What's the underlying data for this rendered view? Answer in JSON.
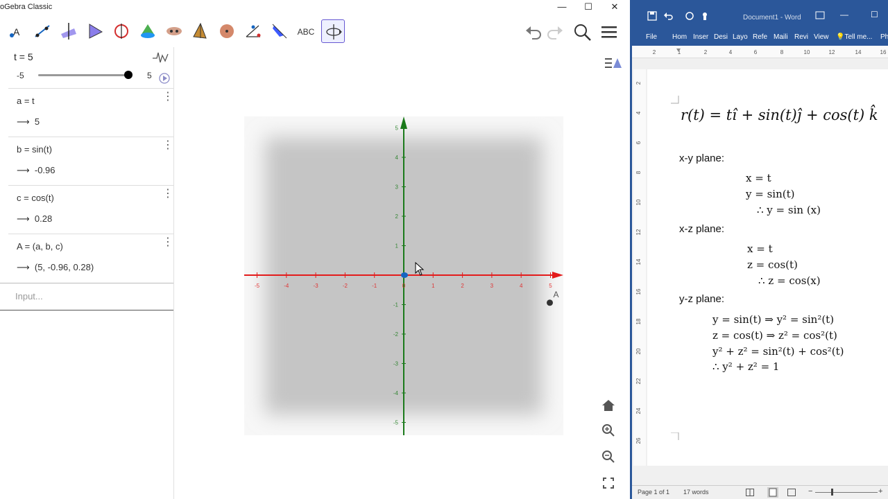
{
  "geogebra": {
    "title": "oGebra Classic",
    "win_controls": {
      "minimize": "—",
      "maximize": "☐",
      "close": "✕"
    },
    "toolbar": {
      "text_tool": "ABC"
    },
    "slider": {
      "label": "t = 5",
      "min": "-5",
      "max": "5",
      "value": 5
    },
    "algebra": [
      {
        "def": "a = t",
        "val": "5"
      },
      {
        "def": "b = sin(t)",
        "val": "-0.96"
      },
      {
        "def": "c = cos(t)",
        "val": "0.28"
      },
      {
        "def": "A = (a, b, c)",
        "val": "(5, -0.96, 0.28)"
      }
    ],
    "arrow": "⟶",
    "input_placeholder": "Input...",
    "graphics": {
      "x_ticks": [
        "-5",
        "-4",
        "-3",
        "-2",
        "-1",
        "0",
        "1",
        "2",
        "3",
        "4",
        "5"
      ],
      "y_ticks_pos": [
        "5",
        "4",
        "3",
        "2",
        "1"
      ],
      "y_ticks_neg": [
        "-1",
        "-2",
        "-3",
        "-4",
        "-5"
      ],
      "point_label": "A",
      "point": {
        "x": 5,
        "y": -0.96
      }
    },
    "colors": {
      "x_axis": "#e31b1b",
      "y_axis": "#1b7a1b",
      "point_blue": "#1565c0",
      "accent": "#6557d2"
    }
  },
  "word": {
    "title": "Document1 - Word",
    "tabs": [
      "File",
      "Hom",
      "Inser",
      "Desi",
      "Layo",
      "Refe",
      "Maili",
      "Revi",
      "View",
      "Tell me...",
      "Ph"
    ],
    "equation_main": "r(t) = tî + sin(t)ĵ + cos(t) k̂",
    "sections": [
      {
        "heading": "x-y plane:",
        "lines": [
          "x = t",
          "y = sin(t)",
          "∴ y = sin (x)"
        ]
      },
      {
        "heading": "x-z plane:",
        "lines": [
          "x = t",
          "z = cos(t)",
          "∴ z = cos(x)"
        ]
      },
      {
        "heading": "y-z plane:",
        "lines": [
          "y = sin(t) ⇒ y² = sin²(t)",
          "z = cos(t) ⇒ z² = cos²(t)",
          "y² + z² = sin²(t) + cos²(t)",
          "∴ y² + z² = 1"
        ]
      }
    ],
    "ruler_numbers": [
      "2",
      "1",
      "2",
      "4",
      "6",
      "8",
      "10",
      "12",
      "14",
      "16"
    ],
    "vruler_numbers": [
      "2",
      "4",
      "6",
      "8",
      "10",
      "12",
      "14",
      "16",
      "18",
      "20",
      "22",
      "24",
      "26"
    ],
    "status": {
      "page": "Page 1 of 1",
      "words": "17 words"
    }
  }
}
